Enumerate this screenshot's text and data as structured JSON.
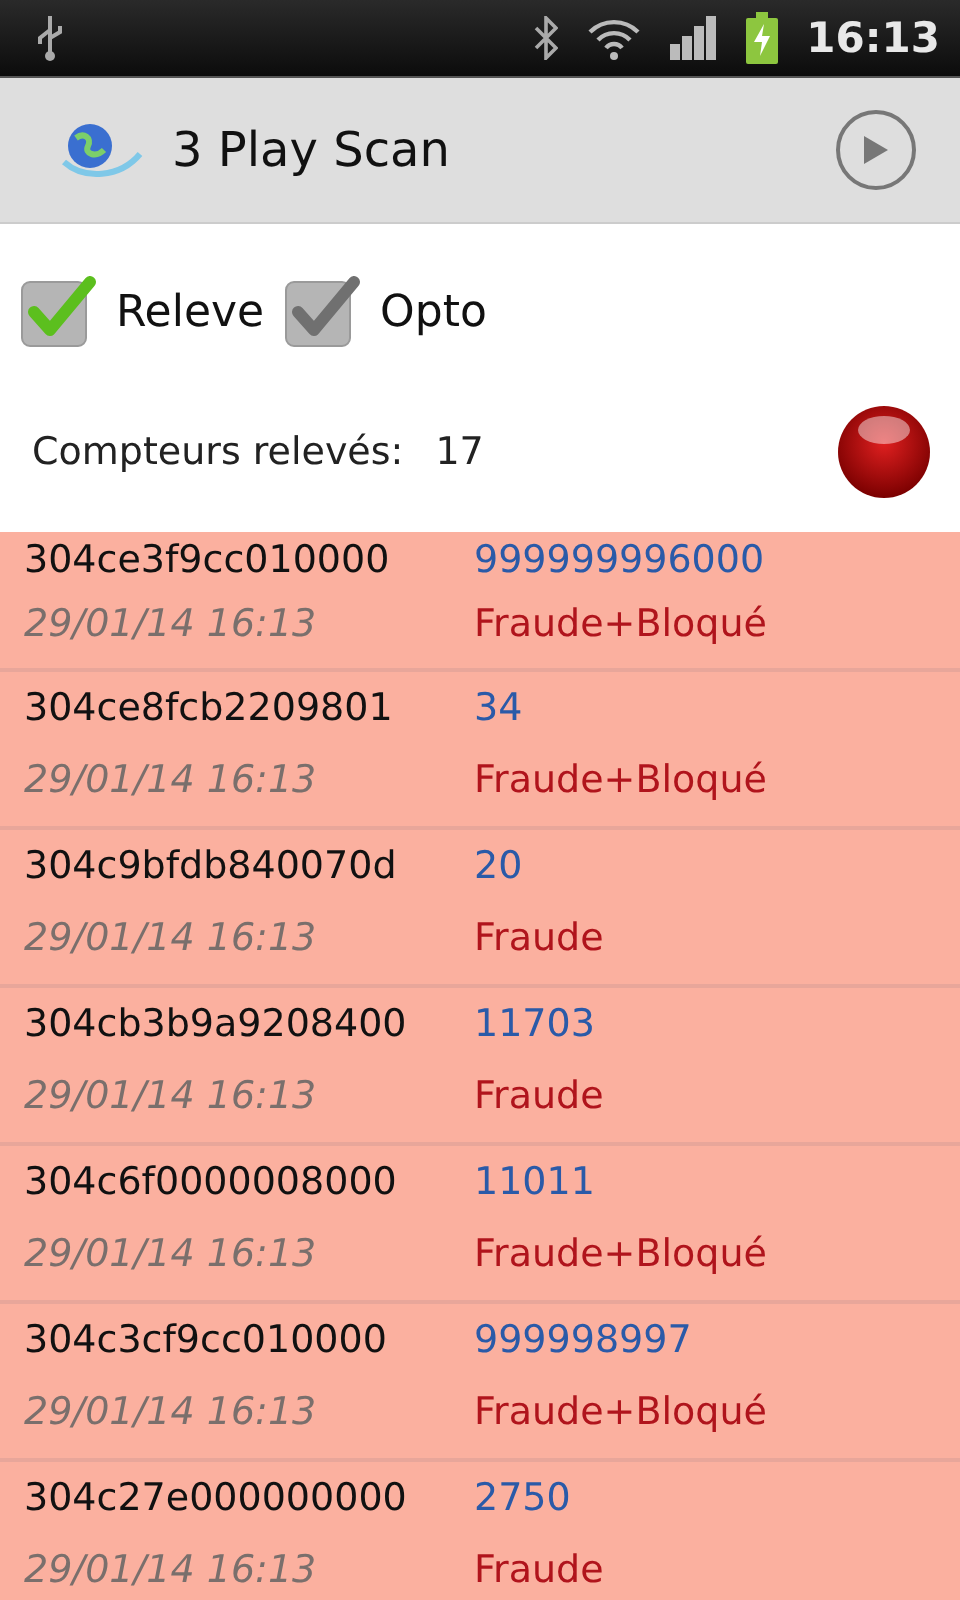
{
  "status_bar": {
    "time": "16:13"
  },
  "app_bar": {
    "title": "3 Play Scan"
  },
  "options": [
    {
      "label": "Releve",
      "checked": true,
      "disabled": false
    },
    {
      "label": "Opto",
      "checked": true,
      "disabled": true
    }
  ],
  "counter": {
    "label": "Compteurs relevés:",
    "value": "17"
  },
  "readings": [
    {
      "id": "304ce3f9cc010000",
      "value": "999999996000",
      "date": "29/01/14 16:13",
      "status": "Fraude+Bloqué"
    },
    {
      "id": "304ce8fcb2209801",
      "value": "34",
      "date": "29/01/14 16:13",
      "status": "Fraude+Bloqué"
    },
    {
      "id": "304c9bfdb840070d",
      "value": "20",
      "date": "29/01/14 16:13",
      "status": "Fraude"
    },
    {
      "id": "304cb3b9a9208400",
      "value": "11703",
      "date": "29/01/14 16:13",
      "status": "Fraude"
    },
    {
      "id": "304c6f0000008000",
      "value": "11011",
      "date": "29/01/14 16:13",
      "status": "Fraude+Bloqué"
    },
    {
      "id": "304c3cf9cc010000",
      "value": "999998997",
      "date": "29/01/14 16:13",
      "status": "Fraude+Bloqué"
    },
    {
      "id": "304c27e000000000",
      "value": "2750",
      "date": "29/01/14 16:13",
      "status": "Fraude"
    }
  ]
}
